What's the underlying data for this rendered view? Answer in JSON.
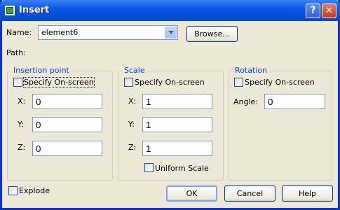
{
  "window": {
    "title": "Insert"
  },
  "titlebar": {
    "help_glyph": "?",
    "close_glyph": "✕"
  },
  "name": {
    "label": "Name:",
    "value": "element6"
  },
  "browse_label": "Browse...",
  "path_label": "Path:",
  "insertion": {
    "title": "Insertion point",
    "specify_label": "Specify On-screen",
    "x_label": "X:",
    "x_value": "0",
    "y_label": "Y:",
    "y_value": "0",
    "z_label": "Z:",
    "z_value": "0"
  },
  "scale": {
    "title": "Scale",
    "specify_label": "Specify On-screen",
    "x_label": "X:",
    "x_value": "1",
    "y_label": "Y:",
    "y_value": "1",
    "z_label": "Z:",
    "z_value": "1",
    "uniform_label": "Uniform Scale"
  },
  "rotation": {
    "title": "Rotation",
    "specify_label": "Specify On-screen",
    "angle_label": "Angle:",
    "angle_value": "0"
  },
  "explode_label": "Explode",
  "buttons": {
    "ok": "OK",
    "cancel": "Cancel",
    "help": "Help"
  },
  "icons": [
    "app-icon",
    "help-icon",
    "close-icon",
    "chevron-down-icon"
  ]
}
